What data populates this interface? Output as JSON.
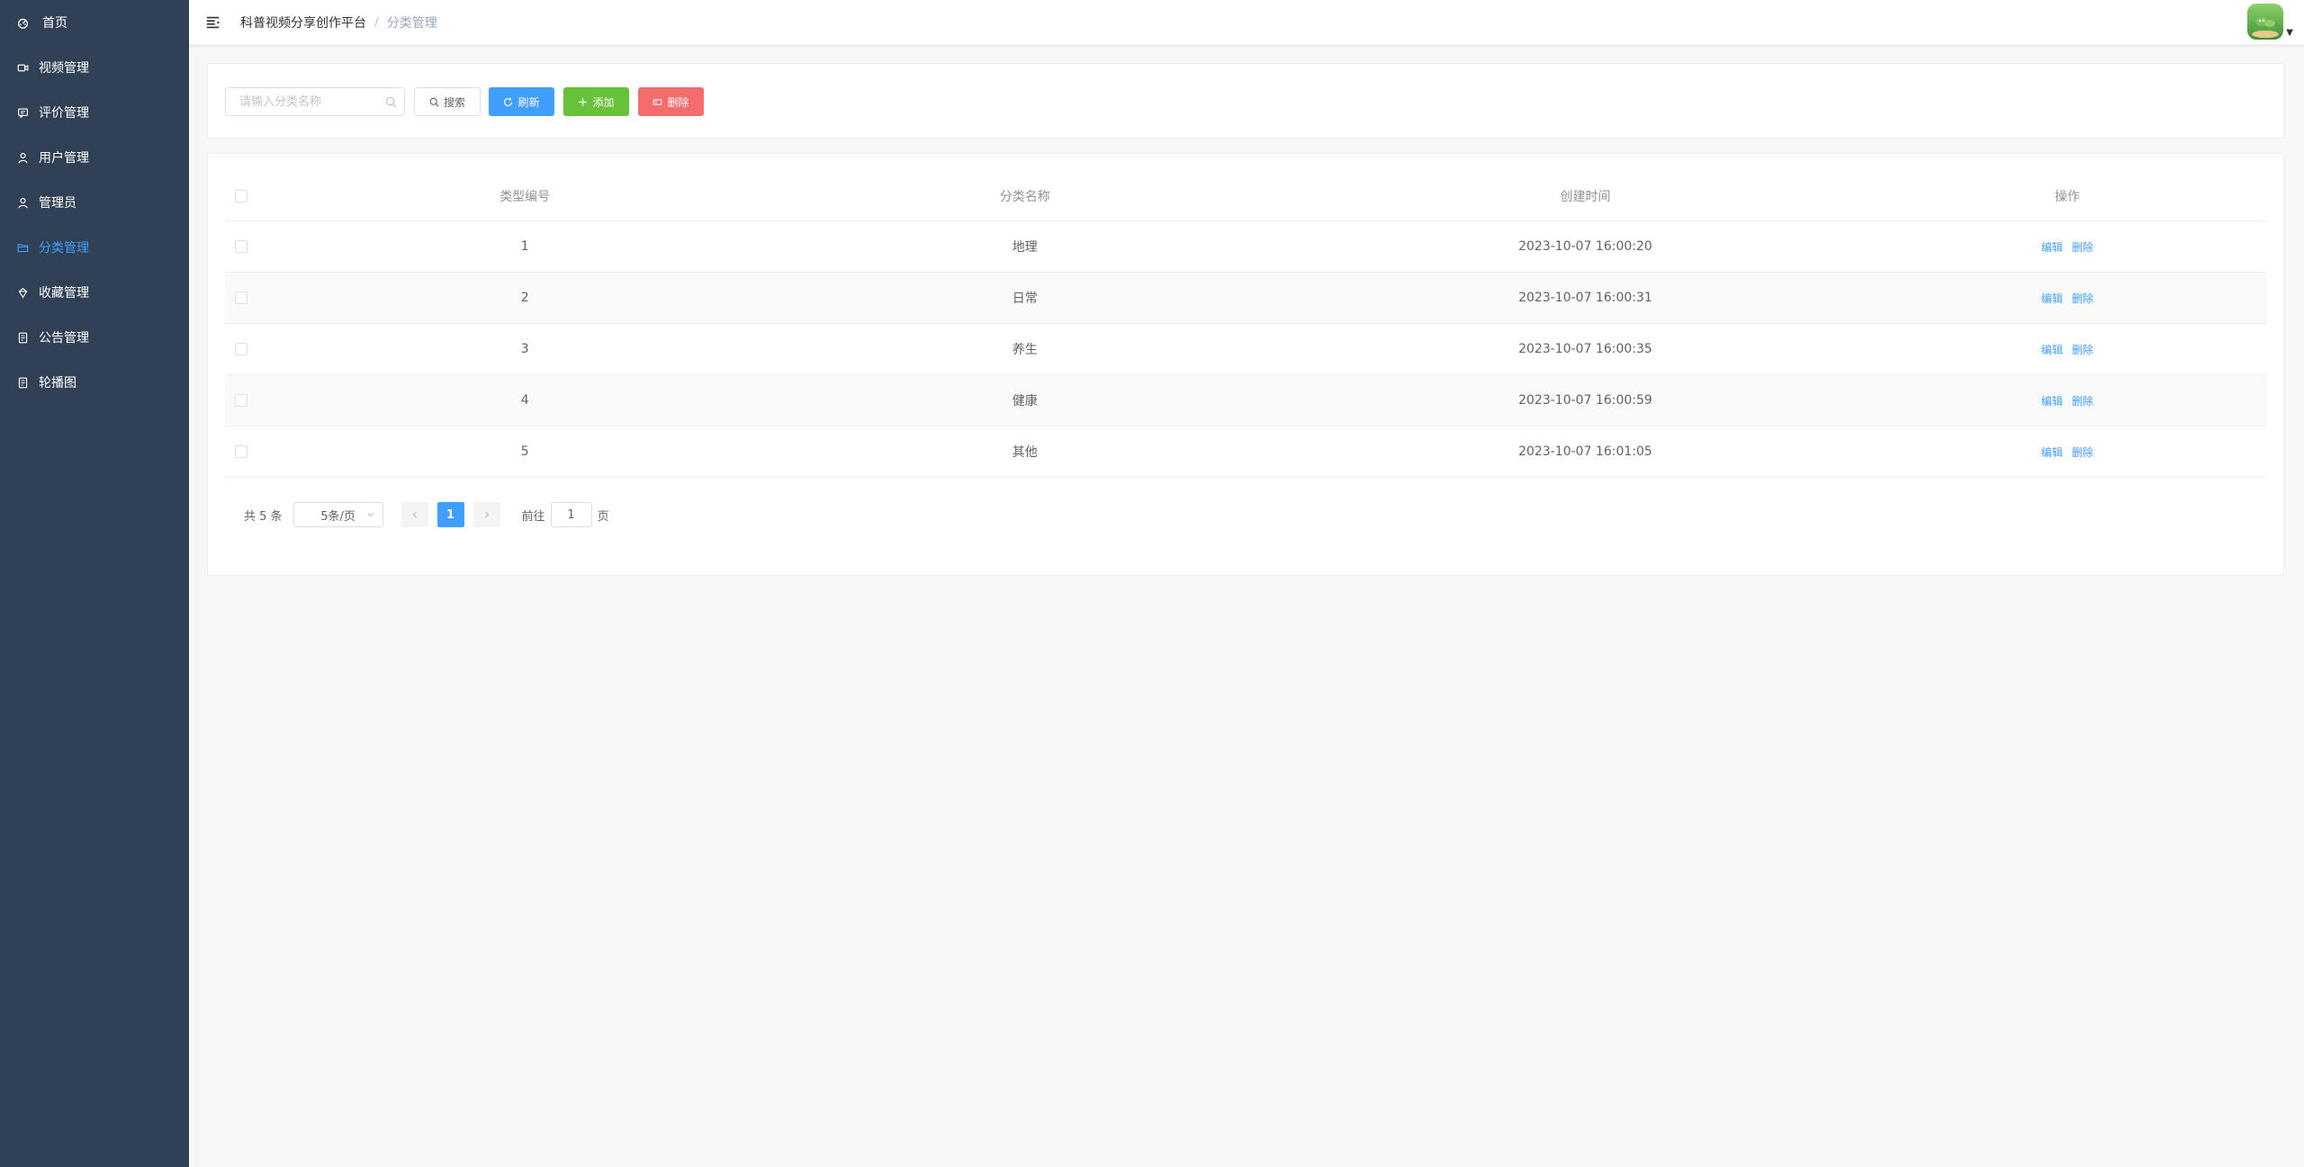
{
  "sidebar": {
    "items": [
      {
        "label": "首页",
        "icon": "dashboard-icon",
        "active": false
      },
      {
        "label": "视频管理",
        "icon": "video-icon",
        "active": false
      },
      {
        "label": "评价管理",
        "icon": "comment-icon",
        "active": false
      },
      {
        "label": "用户管理",
        "icon": "user-icon",
        "active": false
      },
      {
        "label": "管理员",
        "icon": "admin-icon",
        "active": false
      },
      {
        "label": "分类管理",
        "icon": "folder-icon",
        "active": true
      },
      {
        "label": "收藏管理",
        "icon": "collection-icon",
        "active": false
      },
      {
        "label": "公告管理",
        "icon": "notice-icon",
        "active": false
      },
      {
        "label": "轮播图",
        "icon": "carousel-icon",
        "active": false
      }
    ]
  },
  "header": {
    "breadcrumb": [
      "科普视频分享创作平台",
      "分类管理"
    ],
    "separator": "/"
  },
  "toolbar": {
    "search_placeholder": "请输入分类名称",
    "search_label": "搜索",
    "refresh_label": "刷新",
    "add_label": "添加",
    "delete_label": "删除"
  },
  "table": {
    "columns": [
      "类型编号",
      "分类名称",
      "创建时间",
      "操作"
    ],
    "rows": [
      {
        "id": "1",
        "name": "地理",
        "created": "2023-10-07 16:00:20"
      },
      {
        "id": "2",
        "name": "日常",
        "created": "2023-10-07 16:00:31"
      },
      {
        "id": "3",
        "name": "养生",
        "created": "2023-10-07 16:00:35"
      },
      {
        "id": "4",
        "name": "健康",
        "created": "2023-10-07 16:00:59"
      },
      {
        "id": "5",
        "name": "其他",
        "created": "2023-10-07 16:01:05"
      }
    ],
    "edit_label": "编辑",
    "delete_label": "删除"
  },
  "pagination": {
    "total_text": "共 5 条",
    "page_size": "5条/页",
    "current_page": "1",
    "goto_prefix": "前往",
    "goto_value": "1",
    "goto_suffix": "页"
  },
  "colors": {
    "sidebar_bg": "#304156",
    "primary": "#409eff",
    "success": "#67c23a",
    "danger": "#f56c6c"
  }
}
